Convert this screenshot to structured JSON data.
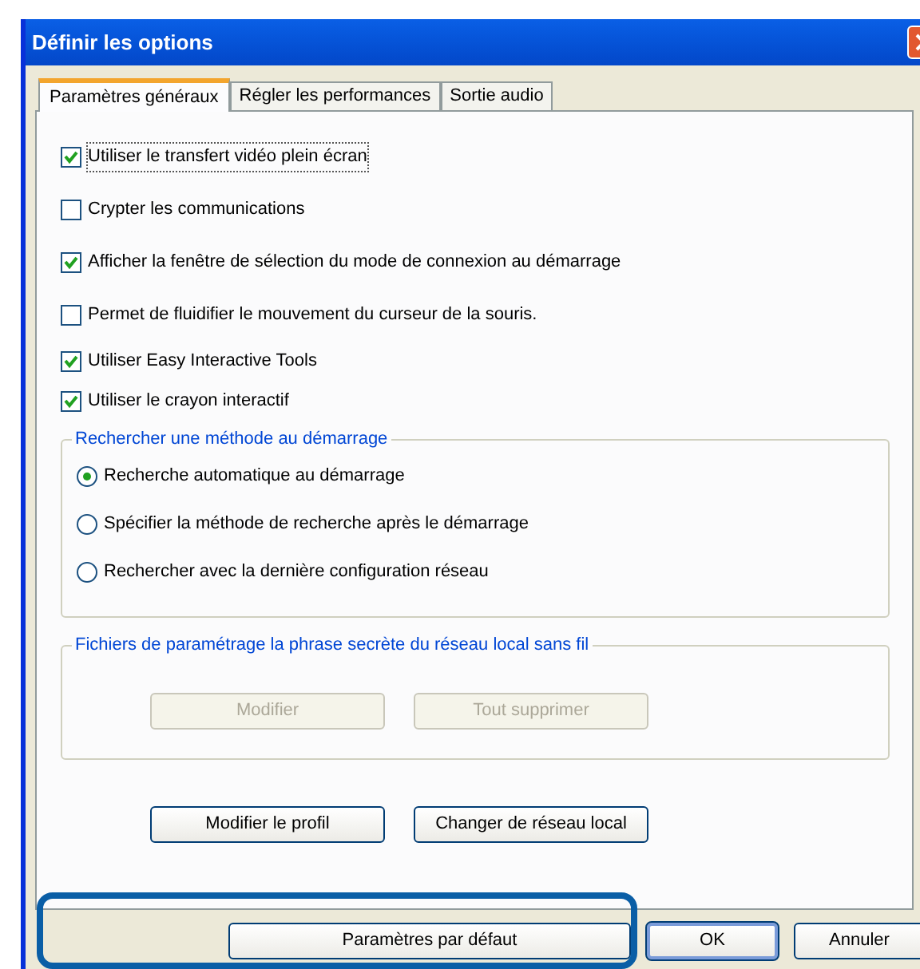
{
  "window": {
    "title": "Définir les options"
  },
  "tabs": [
    {
      "label": "Paramètres généraux",
      "selected": true
    },
    {
      "label": "Régler les performances",
      "selected": false
    },
    {
      "label": "Sortie audio",
      "selected": false
    }
  ],
  "options": [
    {
      "label": "Utiliser le transfert vidéo plein écran",
      "checked": true,
      "focused": true
    },
    {
      "label": "Crypter les communications",
      "checked": false,
      "focused": false
    },
    {
      "label": "Afficher la fenêtre de sélection du mode de connexion au démarrage",
      "checked": true,
      "focused": false
    },
    {
      "label": "Permet de fluidifier le mouvement du curseur de la souris.",
      "checked": false,
      "focused": false
    },
    {
      "label": "Utiliser Easy Interactive Tools",
      "checked": true,
      "focused": false
    },
    {
      "label": "Utiliser le crayon interactif",
      "checked": true,
      "focused": false
    }
  ],
  "search_group": {
    "title": "Rechercher une méthode au démarrage",
    "options": [
      {
        "label": "Recherche automatique au démarrage",
        "selected": true
      },
      {
        "label": "Spécifier la méthode de recherche après le démarrage",
        "selected": false
      },
      {
        "label": "Rechercher avec la dernière configuration réseau",
        "selected": false
      }
    ]
  },
  "passphrase_group": {
    "title": "Fichiers de paramétrage la phrase secrète du réseau local sans fil",
    "buttons": [
      {
        "label": "Modifier",
        "disabled": true
      },
      {
        "label": "Tout supprimer",
        "disabled": true
      }
    ]
  },
  "profile_buttons": [
    {
      "label": "Modifier le profil"
    },
    {
      "label": "Changer de réseau local"
    }
  ],
  "footer_buttons": [
    {
      "label": "Paramètres par défaut",
      "default": false
    },
    {
      "label": "OK",
      "default": true
    },
    {
      "label": "Annuler",
      "default": false
    }
  ]
}
